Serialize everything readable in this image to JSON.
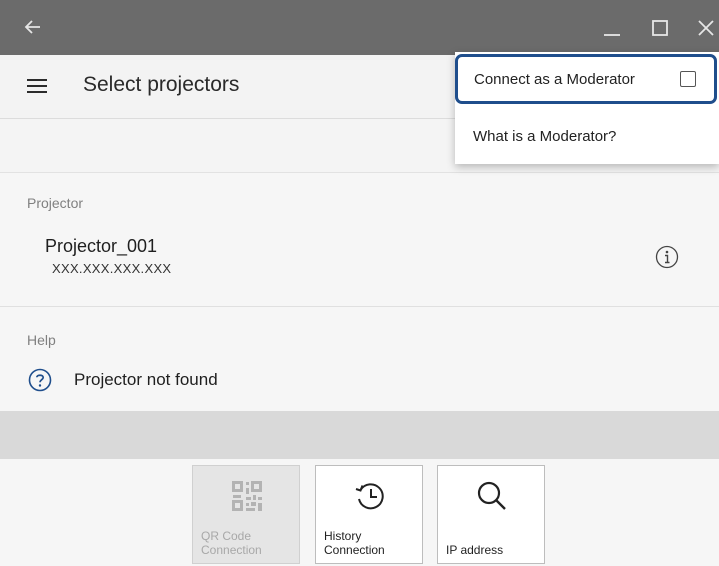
{
  "window": {
    "back_icon": "arrow-left-icon",
    "minimize_icon": "minimize-icon",
    "maximize_icon": "maximize-icon",
    "close_icon": "close-icon"
  },
  "appbar": {
    "menu_icon": "hamburger-menu-icon",
    "title": "Select projectors"
  },
  "projector_section": {
    "label": "Projector",
    "items": [
      {
        "name": "Projector_001",
        "ip": "XXX.XXX.XXX.XXX",
        "info_icon": "info-circle-icon"
      }
    ]
  },
  "help_section": {
    "label": "Help",
    "item": {
      "icon": "question-circle-icon",
      "text": "Projector not found"
    }
  },
  "toolbar": {
    "qr": {
      "label": "QR Code\nConnection",
      "icon": "qr-code-icon",
      "disabled": true
    },
    "history": {
      "label": "History\nConnection",
      "icon": "history-clock-icon"
    },
    "ip": {
      "label": "IP address",
      "icon": "search-icon"
    }
  },
  "popup_menu": {
    "connect_moderator": "Connect as a Moderator",
    "connect_checked": false,
    "what_is_moderator": "What is a Moderator?",
    "highlight_color": "#1f4e8c"
  },
  "colors": {
    "titlebar": "#6b6b6b",
    "appbar": "#f3f3f3",
    "separator_bar": "#d9d9d9"
  }
}
